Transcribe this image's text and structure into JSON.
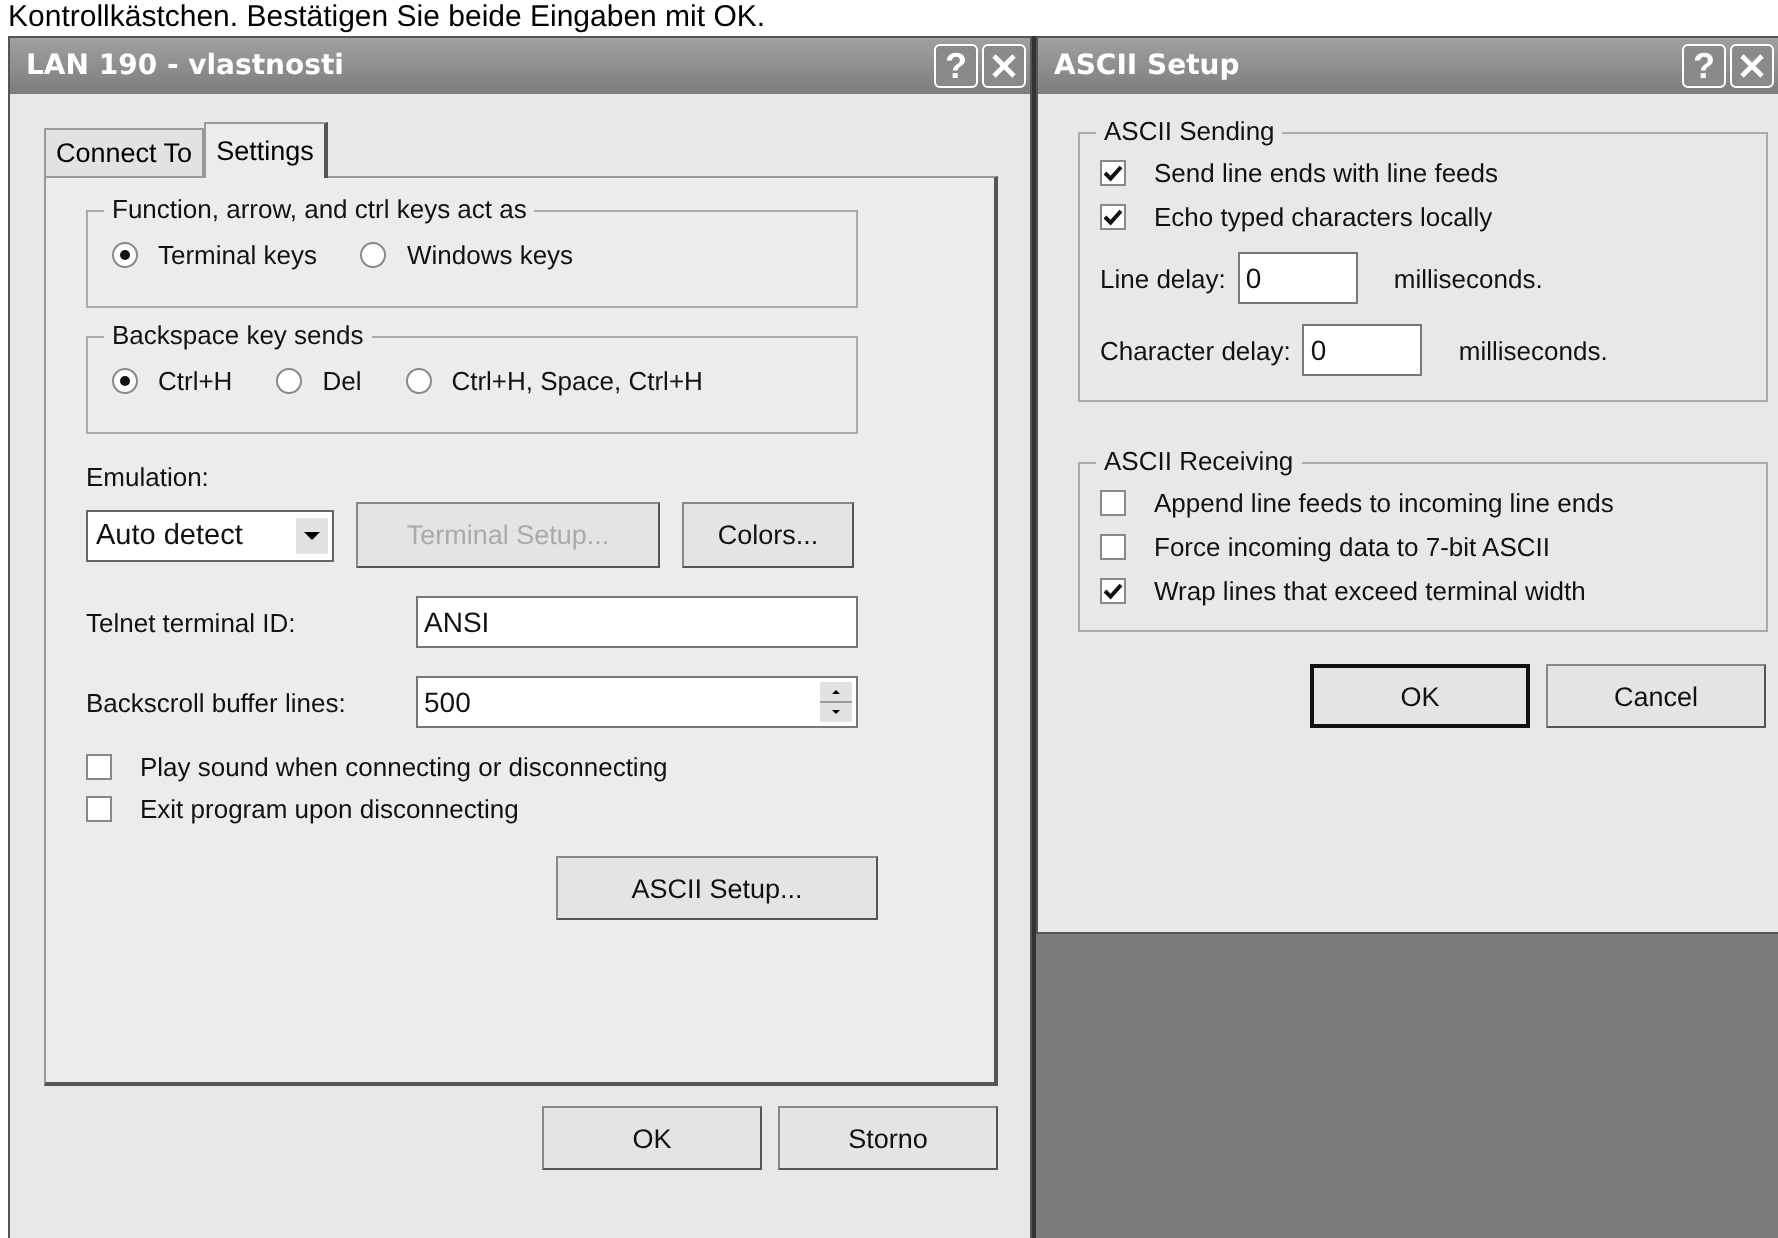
{
  "caption": "Kontrollkästchen. Bestätigen Sie beide Eingaben mit OK.",
  "properties_window": {
    "title": "LAN 190 - vlastnosti",
    "help": "?",
    "tabs": [
      {
        "label": "Connect To",
        "selected": false
      },
      {
        "label": "Settings",
        "selected": true
      }
    ],
    "groups": [
      {
        "label": "Function, arrow, and ctrl keys act as",
        "options": [
          {
            "label": "Terminal keys",
            "selected": true
          },
          {
            "label": "Windows keys",
            "selected": false
          }
        ]
      },
      {
        "label": "Backspace key sends",
        "options": [
          {
            "label": "Ctrl+H",
            "selected": true
          },
          {
            "label": "Del",
            "selected": false
          },
          {
            "label": "Ctrl+H, Space, Ctrl+H",
            "selected": false
          }
        ]
      }
    ],
    "emulation": {
      "label": "Emulation:",
      "value": "Auto detect"
    },
    "emulation_buttons": [
      {
        "label": "Terminal Setup...",
        "disabled": true
      },
      {
        "label": "Colors...",
        "disabled": false
      }
    ],
    "terminal_id": {
      "label": "Telnet terminal ID:",
      "value": "ANSI"
    },
    "backscroll": {
      "label": "Backscroll buffer lines:",
      "value": "500"
    },
    "checkboxes": [
      {
        "label": "Play sound when connecting or disconnecting",
        "checked": false
      },
      {
        "label": "Exit program upon disconnecting",
        "checked": false
      }
    ],
    "ascii_button": "ASCII Setup...",
    "buttons": [
      {
        "label": "OK",
        "default": false
      },
      {
        "label": "Storno",
        "default": false
      }
    ]
  },
  "ascii_window": {
    "title": "ASCII Setup",
    "help": "?",
    "sending": {
      "label": "ASCII Sending",
      "checkboxes": [
        {
          "label": "Send line ends with line feeds",
          "checked": true
        },
        {
          "label": "Echo typed characters locally",
          "checked": true
        }
      ],
      "delays": [
        {
          "label": "Line delay:",
          "value": "0",
          "unit": "milliseconds."
        },
        {
          "label": "Character delay:",
          "value": "0",
          "unit": "milliseconds."
        }
      ]
    },
    "receiving": {
      "label": "ASCII Receiving",
      "checkboxes": [
        {
          "label": "Append line feeds to incoming line ends",
          "checked": false
        },
        {
          "label": "Force incoming data to 7-bit ASCII",
          "checked": false
        },
        {
          "label": "Wrap lines that exceed terminal width",
          "checked": true
        }
      ]
    },
    "buttons": [
      {
        "label": "OK",
        "default": true
      },
      {
        "label": "Cancel",
        "default": false
      }
    ]
  }
}
